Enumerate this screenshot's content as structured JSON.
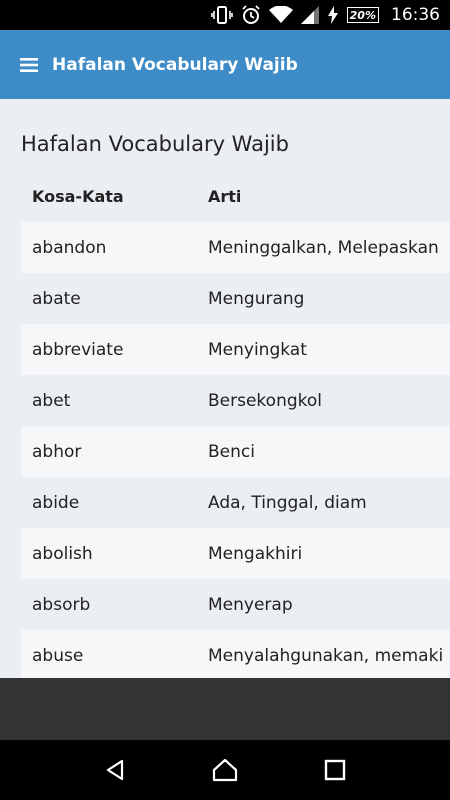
{
  "status_bar": {
    "time": "16:36",
    "battery": "20%",
    "icons": [
      "vibrate-icon",
      "alarm-icon",
      "wifi-icon",
      "signal-icon",
      "charging-icon",
      "battery-icon"
    ]
  },
  "app_bar": {
    "title": "Hafalan Vocabulary Wajib",
    "menu_icon": "hamburger-menu-icon"
  },
  "main": {
    "title": "Hafalan Vocabulary Wajib",
    "table": {
      "headers": [
        "Kosa-Kata",
        "Arti"
      ],
      "rows": [
        {
          "word": "abandon",
          "meaning": "Meninggalkan, Melepaskan"
        },
        {
          "word": "abate",
          "meaning": "Mengurang"
        },
        {
          "word": "abbreviate",
          "meaning": "Menyingkat"
        },
        {
          "word": "abet",
          "meaning": "Bersekongkol"
        },
        {
          "word": "abhor",
          "meaning": "Benci"
        },
        {
          "word": "abide",
          "meaning": "Ada, Tinggal, diam"
        },
        {
          "word": "abolish",
          "meaning": "Mengakhiri"
        },
        {
          "word": "absorb",
          "meaning": "Menyerap"
        },
        {
          "word": "abuse",
          "meaning": "Menyalahgunakan, memaki"
        }
      ]
    }
  },
  "colors": {
    "app_bar": "#3d8cc7",
    "page_bg": "#ebeef3",
    "row_alt": "#f6f7f9",
    "bottom_area": "#333333"
  },
  "nav_bar": {
    "icons": [
      "back-icon",
      "home-icon",
      "recents-icon"
    ]
  }
}
